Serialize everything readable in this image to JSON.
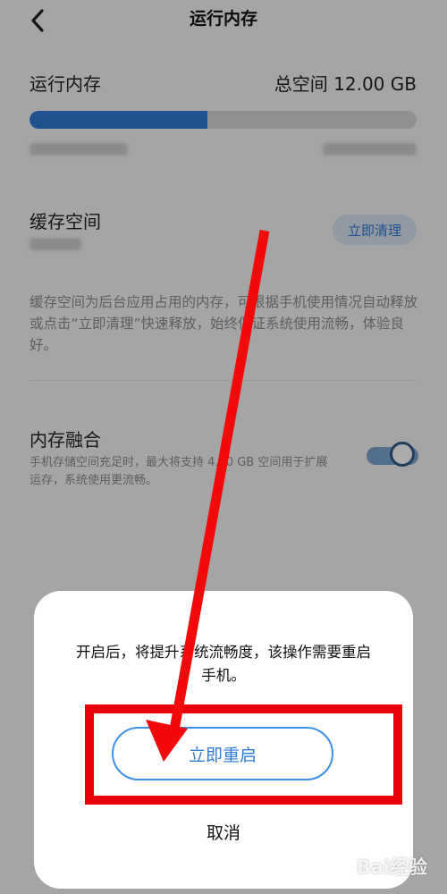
{
  "header": {
    "title": "运行内存"
  },
  "memory": {
    "label": "运行内存",
    "total": "总空间 12.00 GB",
    "usage_fraction": 0.46,
    "accent_color": "#2f7bd6"
  },
  "cache": {
    "label": "缓存空间",
    "clean_button": "立即清理",
    "description": "缓存空间为后台应用占用的内存，可根据手机使用情况自动释放或点击“立即清理”快速释放，始终保证系统使用流畅，体验良好。"
  },
  "fusion": {
    "label": "内存融合",
    "description": "手机存储空间充足时，最大将支持 4.00 GB 空间用于扩展运存，系统使用更流畅。",
    "toggle_on": true
  },
  "dialog": {
    "message": "开启后，将提升系统流畅度，该操作需要重启手机。",
    "confirm_button": "立即重启",
    "cancel_button": "取消"
  },
  "watermark": {
    "text": "Bai经验"
  },
  "icons": {
    "back": "chevron-left-icon",
    "arrow": "red-arrow-annotation"
  }
}
